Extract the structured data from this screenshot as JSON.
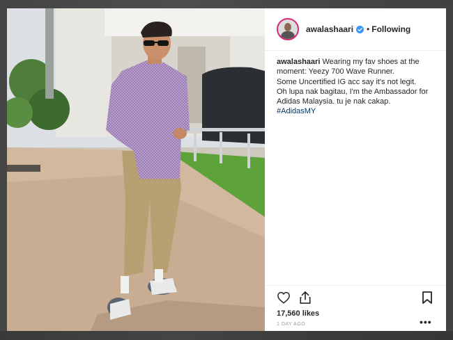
{
  "post": {
    "username": "awalashaari",
    "follow_separator": "•",
    "follow_status": "Following",
    "caption_username": "awalashaari",
    "caption_lines": [
      "Wearing my fav shoes at the moment: Yeezy 700 Wave Runner.",
      "Some Uncertified IG acc say it's not legit.",
      "Oh lupa nak bagitau, I'm the Ambassador for Adidas Malaysia. tu je nak cakap."
    ],
    "hashtag": "#AdidasMY",
    "likes": "17,560 likes",
    "date": "1 DAY AGO",
    "more_glyph": "•••"
  },
  "icons": {
    "verified": "verified-badge-icon",
    "like": "heart-icon",
    "share": "share-icon",
    "save": "bookmark-icon",
    "more": "more-options-icon"
  },
  "colors": {
    "verified_blue": "#3897f0",
    "hashtag": "#003569",
    "avatar_ring": "#d62976",
    "text": "#262626",
    "muted": "#999999"
  }
}
